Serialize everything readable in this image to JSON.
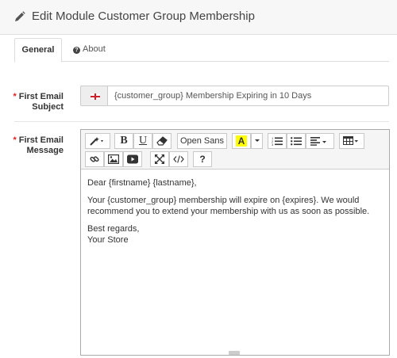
{
  "header": {
    "title": "Edit Module Customer Group Membership",
    "icon": "pencil-icon"
  },
  "tabs": [
    {
      "label": "General",
      "active": true
    },
    {
      "label": "About",
      "icon": "question-circle-icon"
    }
  ],
  "form": {
    "subject": {
      "required_marker": "*",
      "label_line1": "First Email",
      "label_line2": "Subject",
      "value": "{customer_group} Membership Expiring in 10 Days",
      "flag_icon": "england-flag-icon"
    },
    "message": {
      "required_marker": "*",
      "label_line1": "First Email",
      "label_line2": "Message"
    }
  },
  "editor": {
    "toolbar": {
      "font_name": "Open Sans",
      "highlight_letter": "A",
      "highlight_color": "#ffff00",
      "bold": "B",
      "underline": "U",
      "help": "?"
    },
    "content": {
      "greeting": "Dear {firstname} {lastname},",
      "body": "Your {customer_group} membership will expire on {expires}. We would recommend you to extend your membership with us as soon as possible.",
      "closing": "Best regards,",
      "signature": "Your Store"
    }
  }
}
